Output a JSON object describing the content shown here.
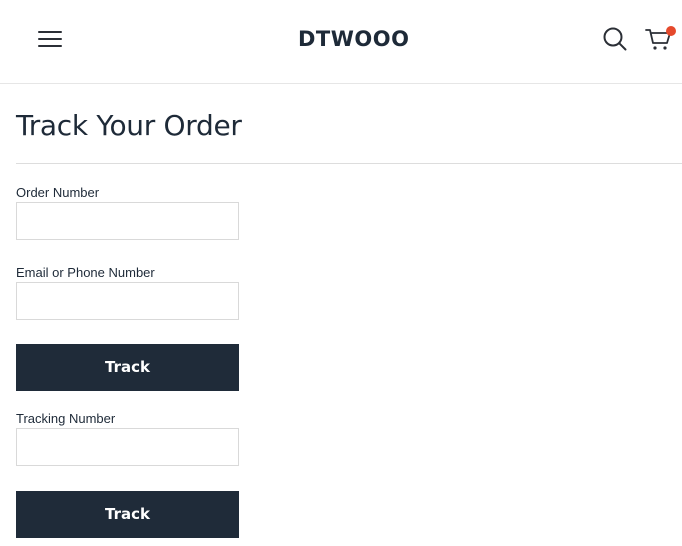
{
  "header": {
    "brand": "DTWOOO",
    "menu_icon": "hamburger-menu-icon",
    "search_icon": "search-icon",
    "cart_icon": "shopping-cart-icon",
    "cart_badge_color": "#e5492c"
  },
  "page": {
    "title": "Track Your Order"
  },
  "order_form": {
    "order_number_label": "Order Number",
    "order_number_value": "",
    "email_label": "Email or Phone Number",
    "email_value": "",
    "submit_label": "Track"
  },
  "tracking_form": {
    "tracking_number_label": "Tracking Number",
    "tracking_number_value": "",
    "submit_label": "Track"
  },
  "colors": {
    "primary": "#1f2b39",
    "text": "#1e2a38",
    "border": "#d9d9d9"
  }
}
